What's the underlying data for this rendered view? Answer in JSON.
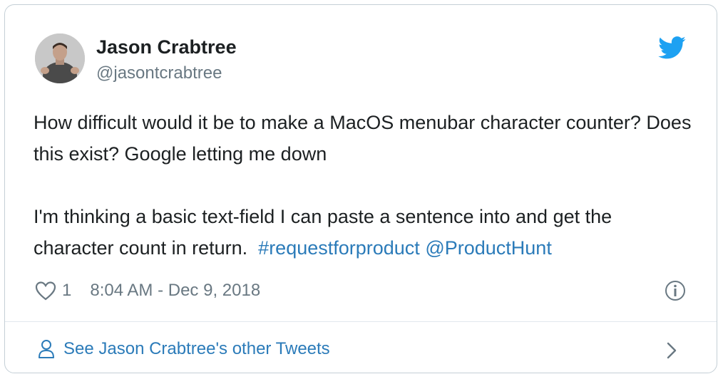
{
  "author": {
    "name": "Jason Crabtree",
    "handle": "@jasontcrabtree"
  },
  "tweet": {
    "paragraph1": "How difficult would it be to make a MacOS menubar character counter? Does this exist? Google letting me down",
    "paragraph2_text": "I'm thinking a basic text-field I can paste a sentence into and get the character count in return.",
    "hashtag": "#requestforproduct",
    "mention": "@ProductHunt"
  },
  "meta": {
    "like_count": "1",
    "timestamp": "8:04 AM - Dec 9, 2018"
  },
  "footer": {
    "label": "See Jason Crabtree's other Tweets"
  },
  "icons": {
    "brand": "twitter-bird-icon",
    "like": "heart-icon",
    "info": "info-icon",
    "profile": "person-icon",
    "next": "chevron-right-icon"
  },
  "colors": {
    "brand_blue": "#1da1f2",
    "link": "#2b7bb9",
    "text": "#1c2022",
    "muted": "#697882",
    "border": "#c4cfd6"
  }
}
